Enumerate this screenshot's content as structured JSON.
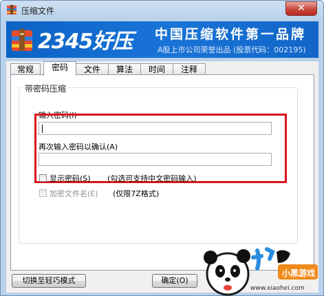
{
  "window": {
    "title": "压缩文件",
    "close_glyph": "✕"
  },
  "banner": {
    "logo_text": "2345好压",
    "slogan": "中国压缩软件第一品牌",
    "subslogan": "A股上市公司荣誉出品 (股票代码：002195)"
  },
  "tabs": [
    {
      "label": "常规",
      "active": false
    },
    {
      "label": "密码",
      "active": true
    },
    {
      "label": "文件",
      "active": false
    },
    {
      "label": "算法",
      "active": false
    },
    {
      "label": "时间",
      "active": false
    },
    {
      "label": "注释",
      "active": false
    }
  ],
  "password_group": {
    "label": "带密码压缩",
    "password_label": "输入密码(I)",
    "password_value": "",
    "confirm_label": "再次输入密码以确认(A)",
    "confirm_value": "",
    "show_password_label": "显示密码(S)",
    "show_password_hint": "(勾选可支持中文密码输入)",
    "show_password_checked": false,
    "encrypt_filenames_label": "加密文件名(E)",
    "encrypt_filenames_hint": "(仅限7Z格式)",
    "encrypt_filenames_checked": false
  },
  "buttons": {
    "switch_mode": "切换至轻巧模式",
    "ok": "确定(O)"
  },
  "watermark": {
    "brand_text": "小黑游戏",
    "url": "www.xiaohei.com"
  },
  "colors": {
    "highlight_border": "#d9141a",
    "banner_blue": "#1a74d8",
    "close_red": "#c9483b"
  }
}
